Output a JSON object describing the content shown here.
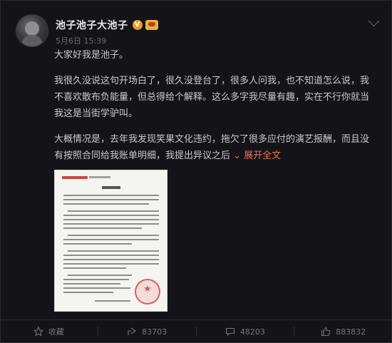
{
  "post": {
    "username": "池子池子大池子",
    "verified_badge": "V",
    "time": "5月6日 15:39",
    "paragraphs": [
      "大家好我是池子。",
      "我很久没说这句开场白了，很久没登台了，很多人问我，也不知道怎么说，我不喜欢散布负能量，但总得给个解释。这么多字我尽量有趣，实在不行你就当我这是当街学驴叫。",
      "大概情况是，去年我发现笑果文化违约，拖欠了很多应付的演艺报酬，而且没有按照合同给我账单明细，我提出异议之后"
    ],
    "expand_label": "展开全文",
    "expand_arrow": "⌄",
    "accent_color": "#eb7350"
  },
  "actions": [
    {
      "icon": "star-icon",
      "label": "收藏"
    },
    {
      "icon": "share-icon",
      "label": "83703"
    },
    {
      "icon": "comment-icon",
      "label": "48203"
    },
    {
      "icon": "like-icon",
      "label": "883832"
    }
  ]
}
